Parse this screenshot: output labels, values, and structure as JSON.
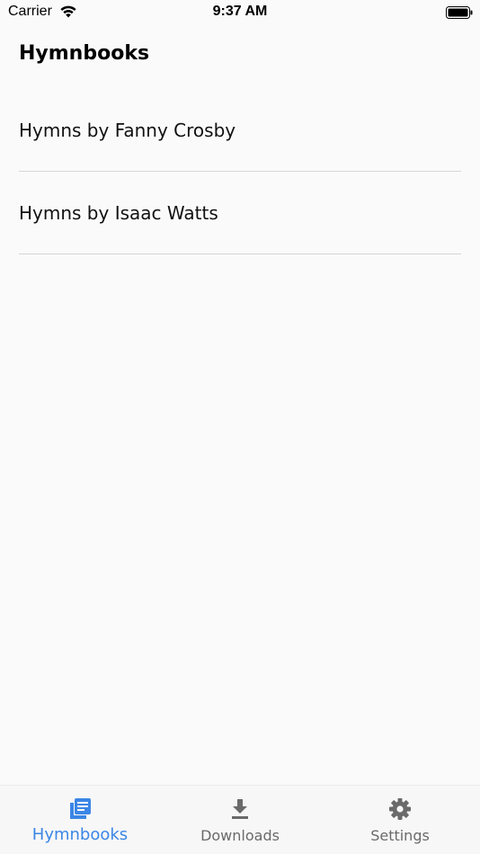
{
  "status_bar": {
    "carrier": "Carrier",
    "time": "9:37 AM"
  },
  "header": {
    "title": "Hymnbooks"
  },
  "hymnbooks": [
    {
      "label": "Hymns by Fanny Crosby"
    },
    {
      "label": "Hymns by Isaac Watts"
    }
  ],
  "tab_bar": {
    "tabs": [
      {
        "label": "Hymnbooks",
        "icon": "book-icon",
        "active": true
      },
      {
        "label": "Downloads",
        "icon": "download-icon",
        "active": false
      },
      {
        "label": "Settings",
        "icon": "gear-icon",
        "active": false
      }
    ]
  },
  "colors": {
    "accent": "#3b86e6",
    "inactive": "#6a6a6a",
    "background": "#fafafa",
    "divider": "#d6d6d6"
  }
}
